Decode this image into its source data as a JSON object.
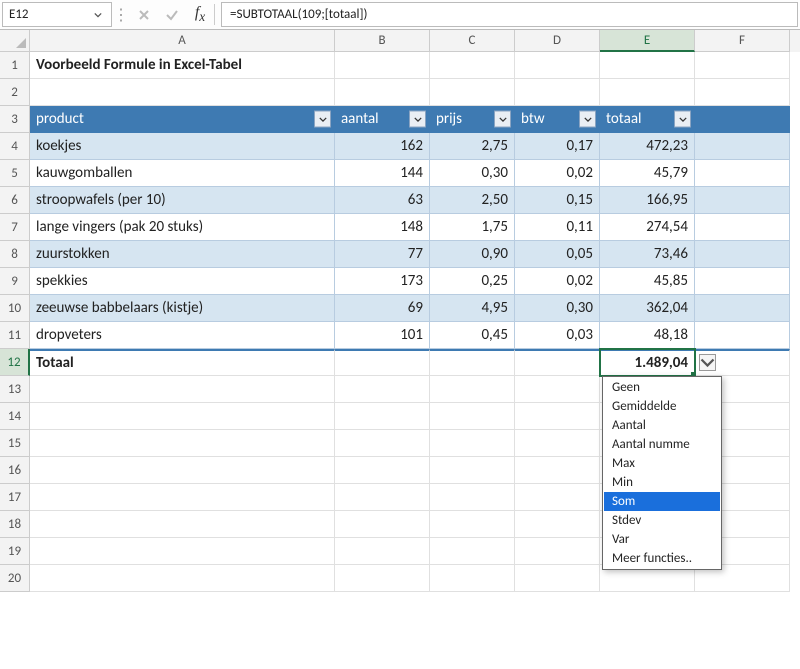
{
  "nameBox": "E12",
  "formula": "=SUBTOTAAL(109;[totaal])",
  "columns": [
    "A",
    "B",
    "C",
    "D",
    "E",
    "F"
  ],
  "activeCol": "E",
  "activeRow": 12,
  "title_row": 1,
  "title": "Voorbeeld Formule in Excel-Tabel",
  "tableHeaders": [
    "product",
    "aantal",
    "prijs",
    "btw",
    "totaal"
  ],
  "rows": [
    {
      "product": "koekjes",
      "aantal": "162",
      "prijs": "2,75",
      "btw": "0,17",
      "totaal": "472,23"
    },
    {
      "product": "kauwgomballen",
      "aantal": "144",
      "prijs": "0,30",
      "btw": "0,02",
      "totaal": "45,79"
    },
    {
      "product": "stroopwafels (per 10)",
      "aantal": "63",
      "prijs": "2,50",
      "btw": "0,15",
      "totaal": "166,95"
    },
    {
      "product": "lange vingers (pak 20 stuks)",
      "aantal": "148",
      "prijs": "1,75",
      "btw": "0,11",
      "totaal": "274,54"
    },
    {
      "product": "zuurstokken",
      "aantal": "77",
      "prijs": "0,90",
      "btw": "0,05",
      "totaal": "73,46"
    },
    {
      "product": "spekkies",
      "aantal": "173",
      "prijs": "0,25",
      "btw": "0,02",
      "totaal": "45,85"
    },
    {
      "product": "zeeuwse babbelaars (kistje)",
      "aantal": "69",
      "prijs": "4,95",
      "btw": "0,30",
      "totaal": "362,04"
    },
    {
      "product": "dropveters",
      "aantal": "101",
      "prijs": "0,45",
      "btw": "0,03",
      "totaal": "48,18"
    }
  ],
  "totalLabel": "Totaal",
  "totalValue": "1.489,04",
  "menu": {
    "items": [
      "Geen",
      "Gemiddelde",
      "Aantal",
      "Aantal numme",
      "Max",
      "Min",
      "Som",
      "Stdev",
      "Var",
      "Meer functies.."
    ],
    "selected": "Som"
  },
  "lastVisibleRow": 20
}
